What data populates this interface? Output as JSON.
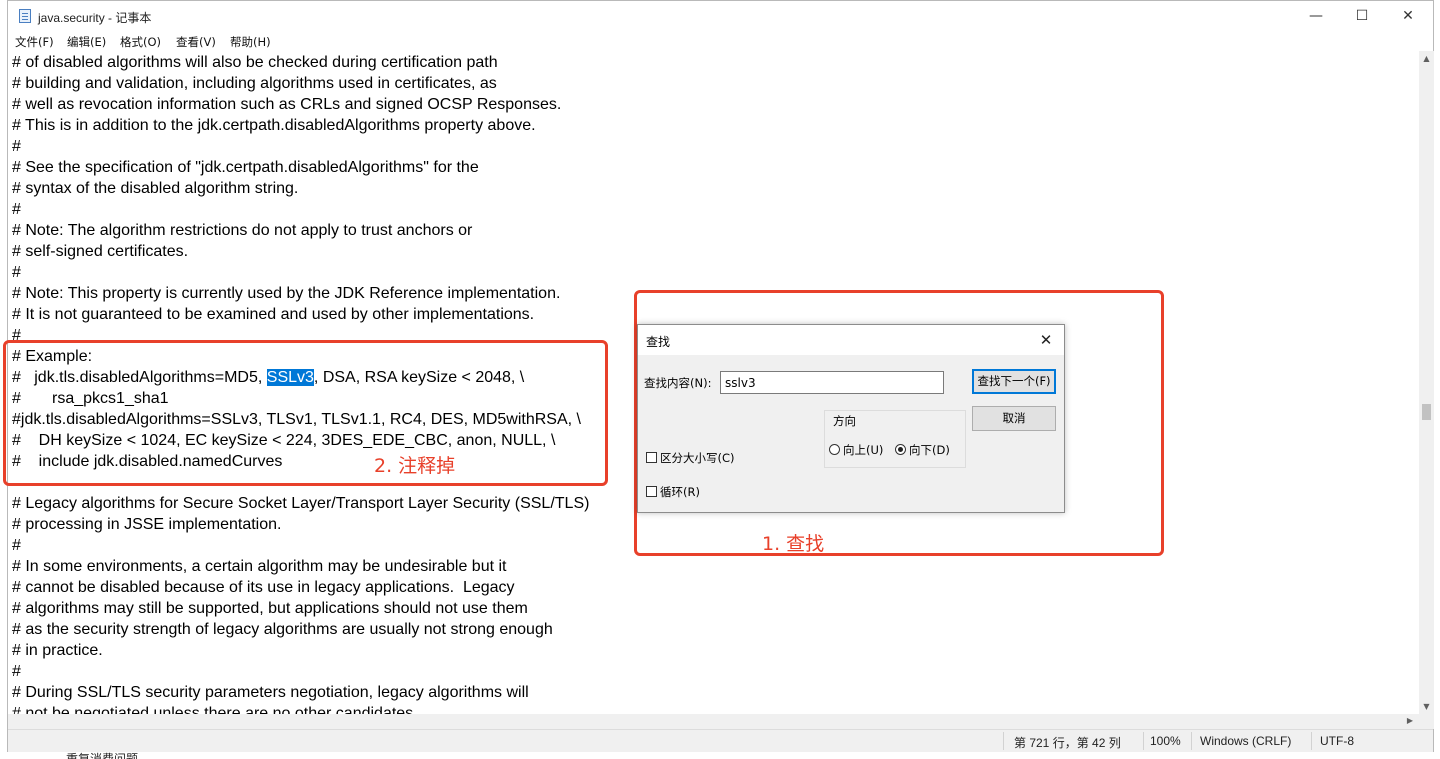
{
  "window": {
    "title": "java.security - 记事本",
    "minimize_glyph": "—",
    "maximize_glyph": "☐",
    "close_glyph": "✕",
    "icon": "notepad-icon"
  },
  "menu": [
    "文件(F)",
    "编辑(E)",
    "格式(O)",
    "查看(V)",
    "帮助(H)"
  ],
  "editor": {
    "lines": [
      "# of disabled algorithms will also be checked during certification path",
      "# building and validation, including algorithms used in certificates, as",
      "# well as revocation information such as CRLs and signed OCSP Responses.",
      "# This is in addition to the jdk.certpath.disabledAlgorithms property above.",
      "#",
      "# See the specification of \"jdk.certpath.disabledAlgorithms\" for the",
      "# syntax of the disabled algorithm string.",
      "#",
      "# Note: The algorithm restrictions do not apply to trust anchors or",
      "# self-signed certificates.",
      "#",
      "# Note: This property is currently used by the JDK Reference implementation.",
      "# It is not guaranteed to be examined and used by other implementations.",
      "#",
      "# Example:",
      "#   jdk.tls.disabledAlgorithms=MD5, SSLv3, DSA, RSA keySize < 2048, \\",
      "#       rsa_pkcs1_sha1",
      "#jdk.tls.disabledAlgorithms=SSLv3, TLSv1, TLSv1.1, RC4, DES, MD5withRSA, \\",
      "#    DH keySize < 1024, EC keySize < 224, 3DES_EDE_CBC, anon, NULL, \\",
      "#    include jdk.disabled.namedCurves",
      "",
      "# Legacy algorithms for Secure Socket Layer/Transport Layer Security (SSL/TLS)",
      "# processing in JSSE implementation.",
      "#",
      "# In some environments, a certain algorithm may be undesirable but it",
      "# cannot be disabled because of its use in legacy applications.  Legacy",
      "# algorithms may still be supported, but applications should not use them",
      "# as the security strength of legacy algorithms are usually not strong enough",
      "# in practice.",
      "#",
      "# During SSL/TLS security parameters negotiation, legacy algorithms will",
      "# not be negotiated unless there are no other candidates"
    ],
    "selected_line_before": "#   jdk.tls.disabledAlgorithms=MD5, ",
    "selected_text": "SSLv3",
    "selected_line_after": ", DSA, RSA keySize < 2048, \\"
  },
  "status": {
    "position": "第 721 行，第 42 列",
    "zoom": "100%",
    "line_ending": "Windows (CRLF)",
    "encoding": "UTF-8"
  },
  "find_dialog": {
    "title": "查找",
    "find_label": "查找内容(N):",
    "find_value": "sslv3",
    "find_next_button": "查找下一个(F)",
    "cancel_button": "取消",
    "direction_label": "方向",
    "up_label": "向上(U)",
    "down_label": "向下(D)",
    "direction_selected": "down",
    "match_case_label": "区分大小写(C)",
    "wrap_label": "循环(R)"
  },
  "annotations": {
    "find_label": "1. 查找",
    "comment_label": "2. 注释掉",
    "color": "#e8402a"
  },
  "below_window_text": "重复消费问题"
}
